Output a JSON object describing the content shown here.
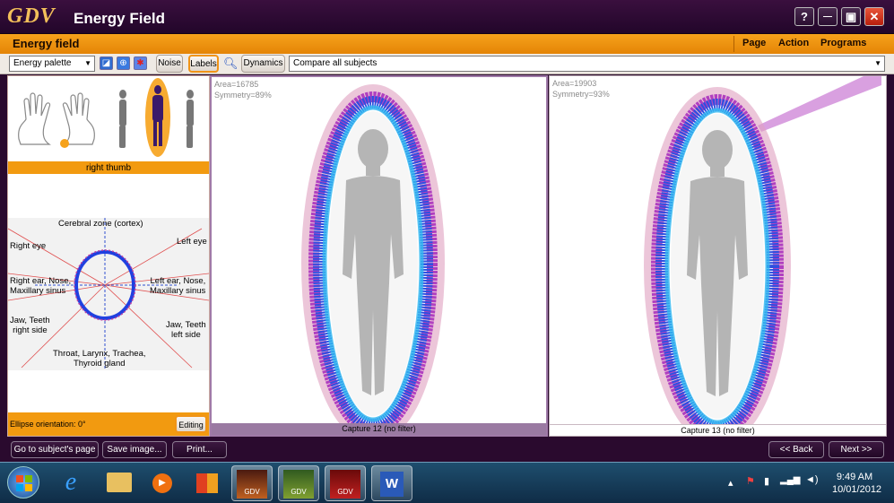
{
  "window": {
    "logo": "GDV",
    "title": "Energy Field",
    "help_label": "?",
    "min_label": "—",
    "max_label": "▣",
    "close_label": "✕"
  },
  "header": {
    "page_title": "Energy field",
    "menu": [
      "Page",
      "Action",
      "Programs"
    ]
  },
  "toolbar": {
    "palette_select": "Energy palette",
    "noise_label": "Noise",
    "labels_label": "Labels",
    "dynamics_label": "Dynamics",
    "compare_select": "Compare all subjects"
  },
  "left_panel": {
    "selected_finger": "right thumb",
    "zones": {
      "cortex": "Cerebral zone (cortex)",
      "right_eye": "Right eye",
      "left_eye": "Left eye",
      "right_ear": "Right ear, Nose,\nMaxillary sinus",
      "left_ear": "Left ear, Nose,\nMaxillary sinus",
      "jaw_right": "Jaw, Teeth\nright side",
      "jaw_left": "Jaw, Teeth\nleft side",
      "throat": "Throat, Larynx, Trachea,\nThyroid gland"
    },
    "ellipse_orientation": "Ellipse orientation: 0°",
    "editing_label": "Editing"
  },
  "captures": [
    {
      "area": "Area=16785",
      "symmetry": "Symmetry=89%",
      "caption": "Capture 12 (no filter)"
    },
    {
      "area": "Area=19903",
      "symmetry": "Symmetry=93%",
      "caption": "Capture 13 (no filter)"
    }
  ],
  "bottom": {
    "subject_page": "Go to subject's page",
    "save_image": "Save image...",
    "print": "Print...",
    "back": "<< Back",
    "next": "Next >>"
  },
  "taskbar": {
    "time": "9:49 AM",
    "date": "10/01/2012",
    "gdv_label": "GDV"
  },
  "colors": {
    "accent": "#f29a10",
    "dark": "#2a0a2e",
    "aura_blue": "#2f4fe0",
    "aura_magenta": "#c040a0"
  }
}
